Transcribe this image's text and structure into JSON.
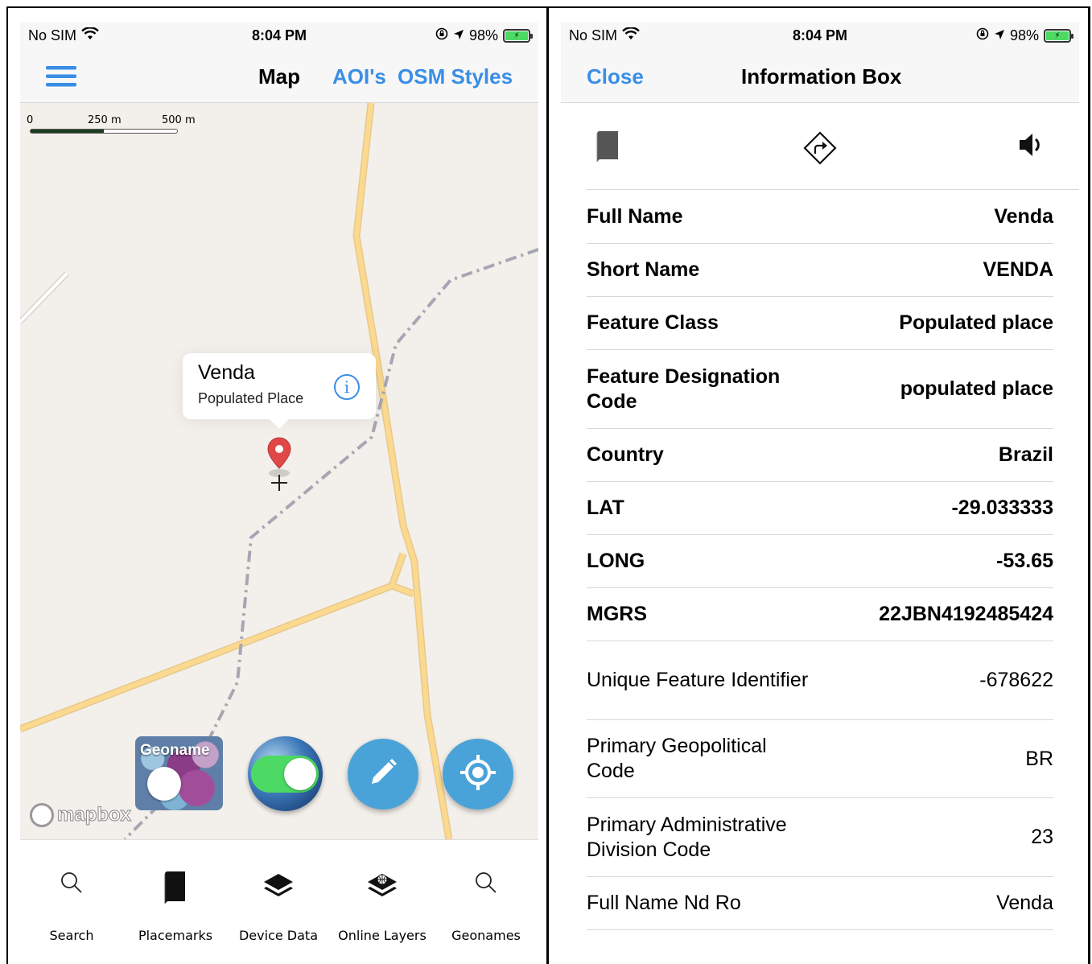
{
  "status": {
    "carrier": "No SIM",
    "time": "8:04 PM",
    "battery": "98%"
  },
  "map_screen": {
    "nav": {
      "title": "Map",
      "aois_label": "AOI's",
      "osm_styles_label": "OSM Styles"
    },
    "scale": {
      "zero": "0",
      "mid": "250 m",
      "max": "500 m"
    },
    "callout": {
      "title": "Venda",
      "subtitle": "Populated Place"
    },
    "geoname_label": "Geoname",
    "mapbox_label": "mapbox",
    "tabs": [
      {
        "label": "Search",
        "icon": "search-icon"
      },
      {
        "label": "Placemarks",
        "icon": "bookmark-icon"
      },
      {
        "label": "Device Data",
        "icon": "layers-icon"
      },
      {
        "label": "Online Layers",
        "icon": "online-layers-icon"
      },
      {
        "label": "Geonames",
        "icon": "search-icon"
      }
    ]
  },
  "info_screen": {
    "nav": {
      "close_label": "Close",
      "title": "Information Box"
    },
    "actions": [
      "bookmark-icon",
      "directions-icon",
      "speaker-icon"
    ],
    "rows": [
      {
        "key": "Full Name",
        "value": "Venda",
        "bold": true
      },
      {
        "key": "Short Name",
        "value": "VENDA",
        "bold": true
      },
      {
        "key": "Feature Class",
        "value": "Populated place",
        "bold": true
      },
      {
        "key": "Feature Designation Code",
        "value": "populated place",
        "bold": true
      },
      {
        "key": "Country",
        "value": "Brazil",
        "bold": true
      },
      {
        "key": "LAT",
        "value": "-29.033333",
        "bold": true
      },
      {
        "key": "LONG",
        "value": "-53.65",
        "bold": true
      },
      {
        "key": "MGRS",
        "value": "22JBN4192485424",
        "bold": true
      },
      {
        "key": "Unique Feature Identifier",
        "value": "-678622",
        "bold": false
      },
      {
        "key": "Primary Geopolitical Code",
        "value": "BR",
        "bold": false
      },
      {
        "key": "Primary Administrative Division Code",
        "value": "23",
        "bold": false
      },
      {
        "key": "Full Name Nd Ro",
        "value": "Venda",
        "bold": false
      }
    ]
  },
  "colors": {
    "accent": "#3a8ee6",
    "map_background": "#f3efea",
    "road": "#fbd98f",
    "boundary": "#a7a6b3",
    "pin": "#e04848",
    "fab": "#4aa3d8",
    "toggle_on": "#4cd964"
  }
}
